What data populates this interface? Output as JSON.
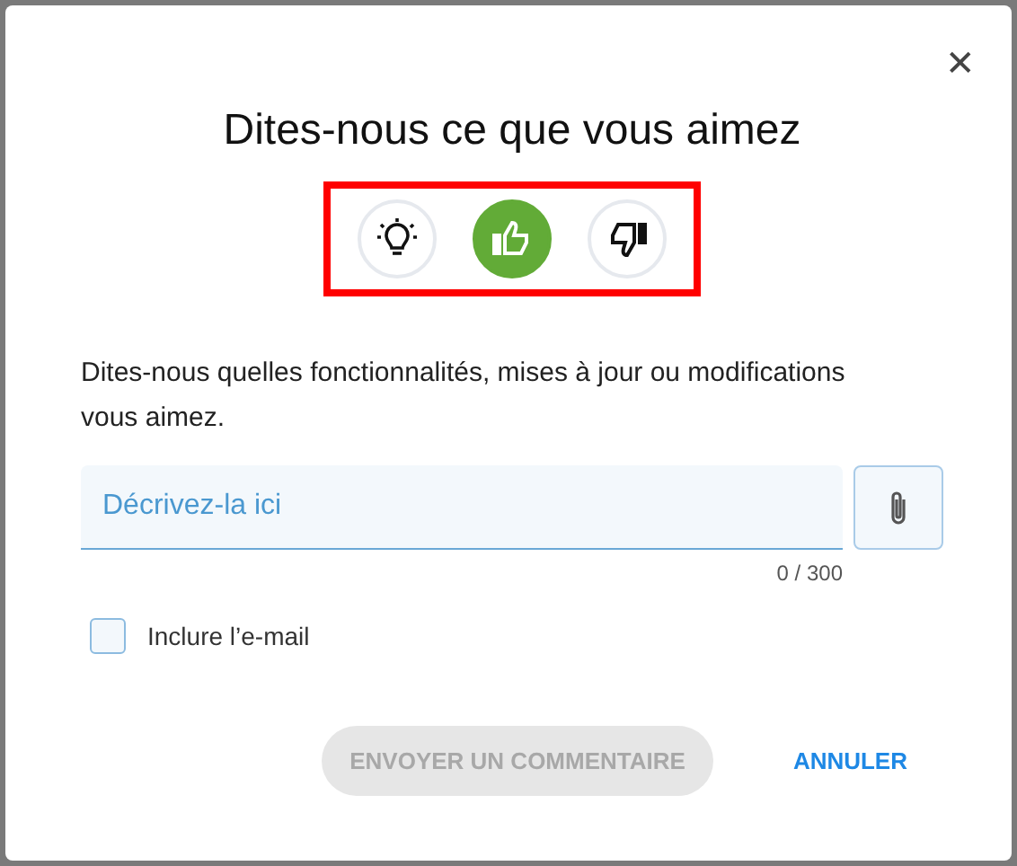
{
  "dialog": {
    "title": "Dites-nous ce que vous aimez",
    "close": "✕"
  },
  "feedback_types": {
    "highlighted": true,
    "items": [
      {
        "kind": "idea",
        "selected": false
      },
      {
        "kind": "like",
        "selected": true
      },
      {
        "kind": "dislike",
        "selected": false
      }
    ]
  },
  "prompt": "Dites-nous quelles fonctionnalités, mises à jour ou modifications vous aimez.",
  "description": {
    "placeholder": "Décrivez-la ici",
    "counter": "0 / 300"
  },
  "include_email": {
    "label": "Inclure l’e-mail",
    "checked": false
  },
  "buttons": [
    {
      "label": "ENVOYER UN COMMENTAIRE",
      "kind": "primary",
      "disabled": true
    },
    {
      "label": "ANNULER",
      "kind": "text",
      "disabled": false
    }
  ]
}
